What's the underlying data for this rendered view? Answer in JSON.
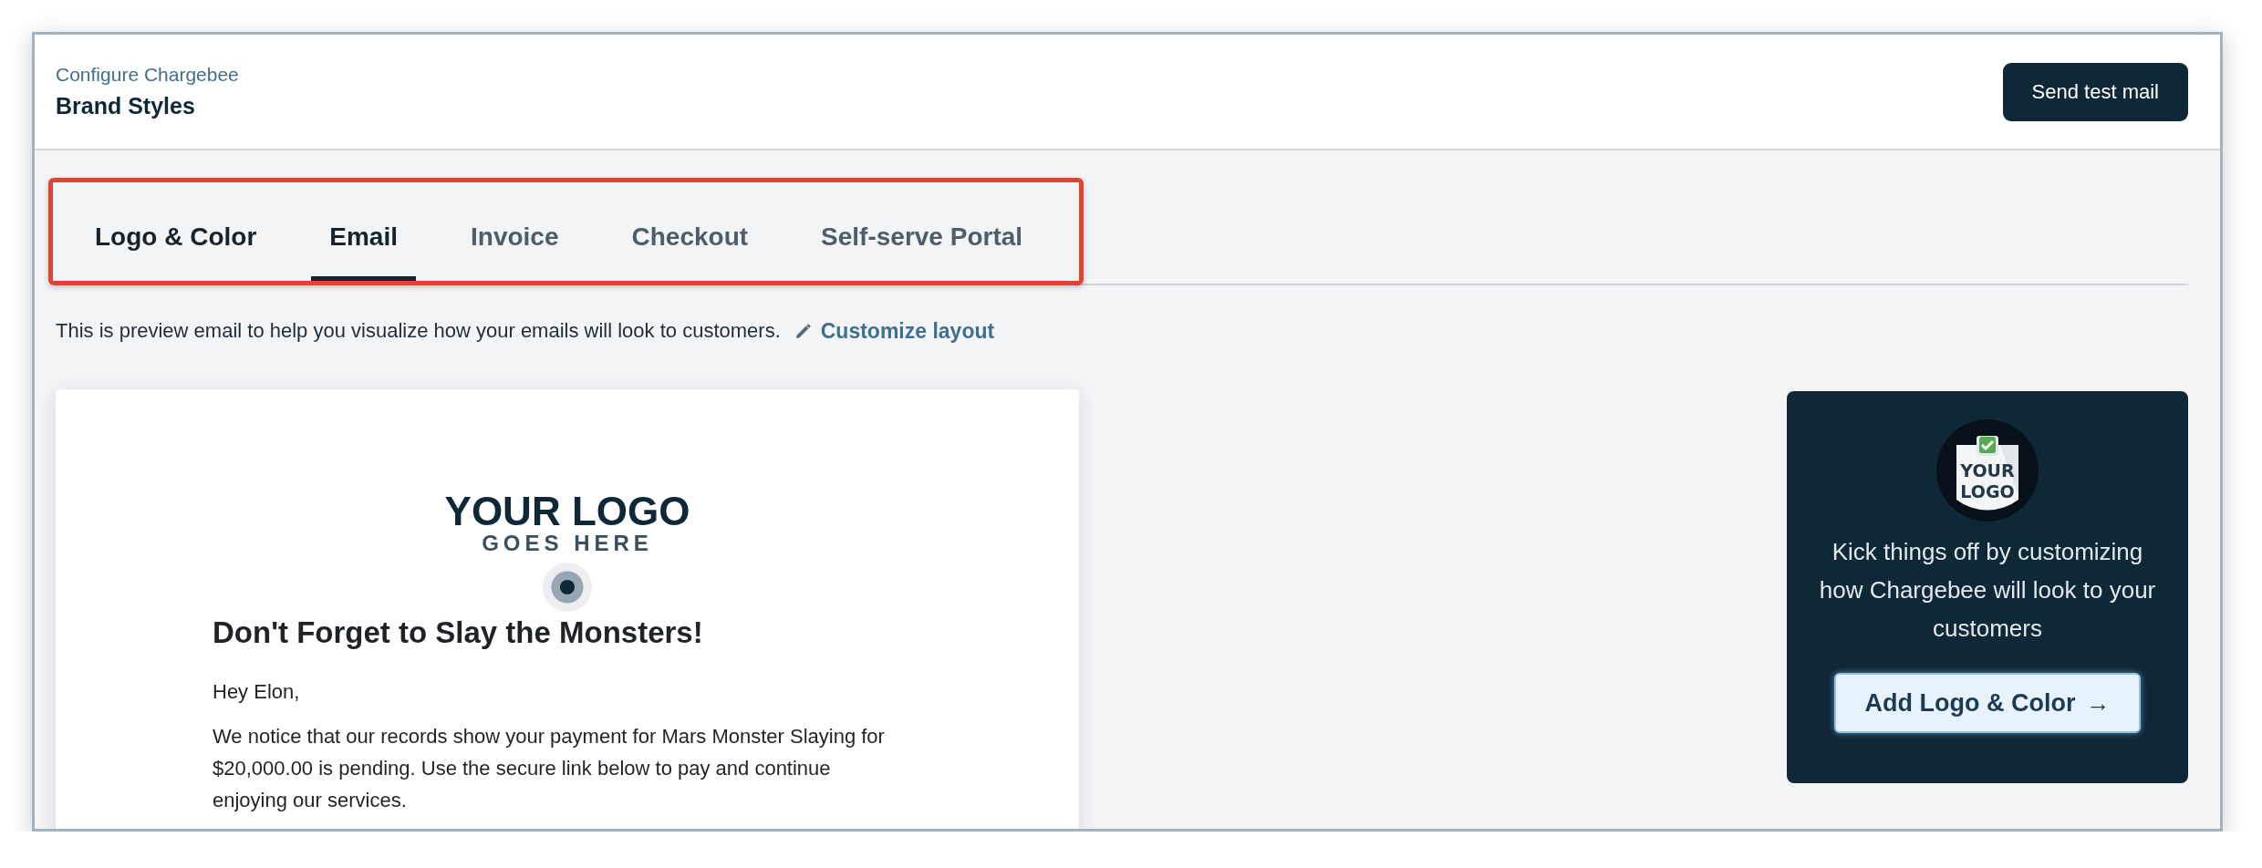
{
  "header": {
    "breadcrumb": "Configure Chargebee",
    "title": "Brand Styles",
    "action_button": "Send test mail"
  },
  "tabs_highlighted": true,
  "tabs": [
    {
      "label": "Logo & Color",
      "selected": false,
      "hovered": true
    },
    {
      "label": "Email",
      "selected": true,
      "hovered": false
    },
    {
      "label": "Invoice",
      "selected": false,
      "hovered": false
    },
    {
      "label": "Checkout",
      "selected": false,
      "hovered": false
    },
    {
      "label": "Self-serve Portal",
      "selected": false,
      "hovered": false
    }
  ],
  "description": "This is preview email to help you visualize how your emails will look to customers.",
  "customize_link": "Customize layout",
  "email_preview": {
    "logo_main": "YOUR LOGO",
    "logo_sub": "GOES HERE",
    "heading": "Don't Forget to Slay the Monsters!",
    "greeting": "Hey Elon,",
    "body": "We notice that our records show your payment for Mars Monster Slaying for $20,000.00 is pending. Use the secure link below to pay and continue enjoying our services."
  },
  "promo_panel": {
    "badge_lines": [
      "YOUR",
      "LOGO"
    ],
    "text": "Kick things off by customizing how Chargebee will look to your customers",
    "button": "Add Logo & Color",
    "button_arrow": "→"
  }
}
